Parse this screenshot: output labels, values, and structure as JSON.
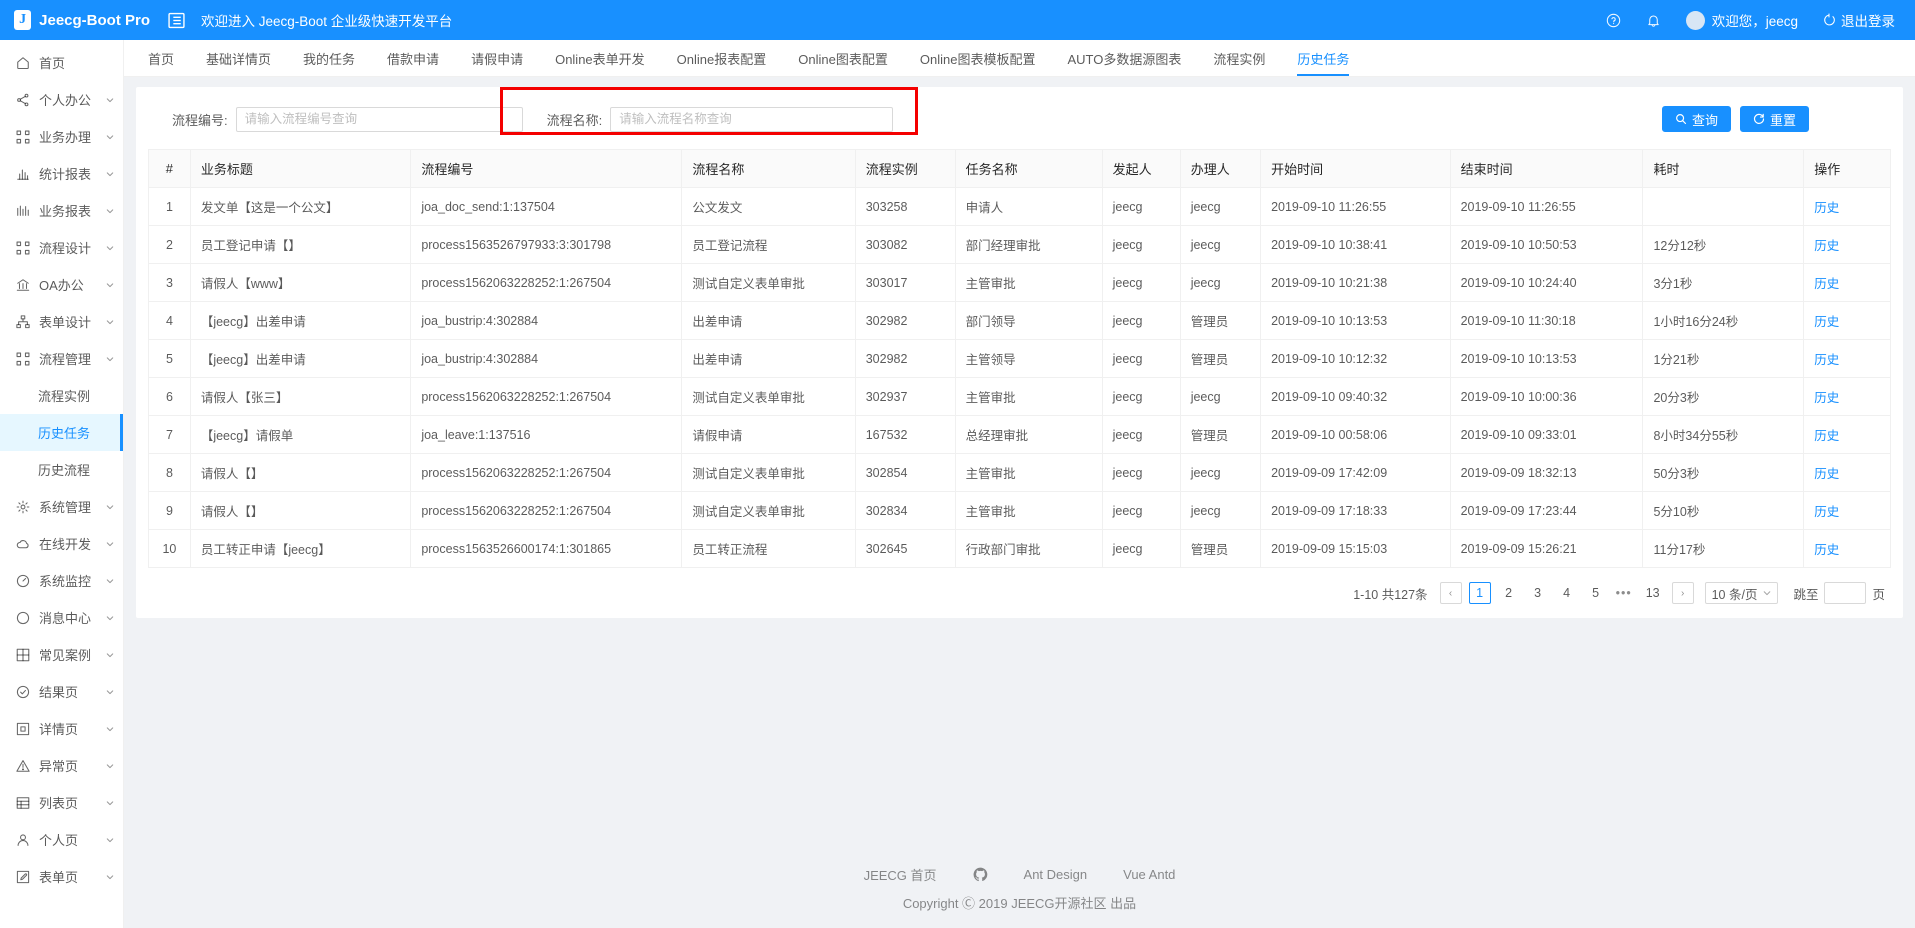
{
  "header": {
    "brand_initial": "J",
    "brand_name": "Jeecg-Boot Pro",
    "welcome_banner": "欢迎进入 Jeecg-Boot 企业级快速开发平台",
    "help_icon": "question-circle-icon",
    "bell_icon": "bell-icon",
    "user_label": "欢迎您，jeecg",
    "logout_label": "退出登录"
  },
  "sidebar": {
    "items": [
      {
        "label": "首页",
        "icon": "home-icon",
        "has_arrow": false,
        "selected": false,
        "sub": false
      },
      {
        "label": "个人办公",
        "icon": "share-icon",
        "has_arrow": true,
        "selected": false,
        "sub": false
      },
      {
        "label": "业务办理",
        "icon": "cluster-icon",
        "has_arrow": true,
        "selected": false,
        "sub": false
      },
      {
        "label": "统计报表",
        "icon": "bar-chart-icon",
        "has_arrow": true,
        "selected": false,
        "sub": false
      },
      {
        "label": "业务报表",
        "icon": "chart-icon",
        "has_arrow": true,
        "selected": false,
        "sub": false
      },
      {
        "label": "流程设计",
        "icon": "cluster-icon",
        "has_arrow": true,
        "selected": false,
        "sub": false
      },
      {
        "label": "OA办公",
        "icon": "bank-icon",
        "has_arrow": true,
        "selected": false,
        "sub": false
      },
      {
        "label": "表单设计",
        "icon": "apartment-icon",
        "has_arrow": true,
        "selected": false,
        "sub": false
      },
      {
        "label": "流程管理",
        "icon": "cluster-icon",
        "has_arrow": true,
        "selected": false,
        "sub": false
      },
      {
        "label": "流程实例",
        "icon": "",
        "has_arrow": false,
        "selected": false,
        "sub": true
      },
      {
        "label": "历史任务",
        "icon": "",
        "has_arrow": false,
        "selected": true,
        "sub": true
      },
      {
        "label": "历史流程",
        "icon": "",
        "has_arrow": false,
        "selected": false,
        "sub": true
      },
      {
        "label": "系统管理",
        "icon": "gear-icon",
        "has_arrow": true,
        "selected": false,
        "sub": false
      },
      {
        "label": "在线开发",
        "icon": "cloud-icon",
        "has_arrow": true,
        "selected": false,
        "sub": false
      },
      {
        "label": "系统监控",
        "icon": "dashboard-icon",
        "has_arrow": true,
        "selected": false,
        "sub": false
      },
      {
        "label": "消息中心",
        "icon": "circle-icon",
        "has_arrow": true,
        "selected": false,
        "sub": false
      },
      {
        "label": "常见案例",
        "icon": "grid-icon",
        "has_arrow": true,
        "selected": false,
        "sub": false
      },
      {
        "label": "结果页",
        "icon": "check-circle-icon",
        "has_arrow": true,
        "selected": false,
        "sub": false
      },
      {
        "label": "详情页",
        "icon": "profile-icon",
        "has_arrow": true,
        "selected": false,
        "sub": false
      },
      {
        "label": "异常页",
        "icon": "warning-icon",
        "has_arrow": true,
        "selected": false,
        "sub": false
      },
      {
        "label": "列表页",
        "icon": "table-icon",
        "has_arrow": true,
        "selected": false,
        "sub": false
      },
      {
        "label": "个人页",
        "icon": "user-icon",
        "has_arrow": true,
        "selected": false,
        "sub": false
      },
      {
        "label": "表单页",
        "icon": "form-icon",
        "has_arrow": true,
        "selected": false,
        "sub": false
      }
    ]
  },
  "tabs": [
    {
      "label": "首页",
      "active": false
    },
    {
      "label": "基础详情页",
      "active": false
    },
    {
      "label": "我的任务",
      "active": false
    },
    {
      "label": "借款申请",
      "active": false
    },
    {
      "label": "请假申请",
      "active": false
    },
    {
      "label": "Online表单开发",
      "active": false
    },
    {
      "label": "Online报表配置",
      "active": false
    },
    {
      "label": "Online图表配置",
      "active": false
    },
    {
      "label": "Online图表模板配置",
      "active": false
    },
    {
      "label": "AUTO多数据源图表",
      "active": false
    },
    {
      "label": "流程实例",
      "active": false
    },
    {
      "label": "历史任务",
      "active": true
    }
  ],
  "search": {
    "process_no_label": "流程编号:",
    "process_no_placeholder": "请输入流程编号查询",
    "process_no_value": "",
    "process_name_label": "流程名称:",
    "process_name_placeholder": "请输入流程名称查询",
    "process_name_value": "",
    "query_button": "查询",
    "reset_button": "重置",
    "query_icon": "search-icon",
    "reset_icon": "reload-icon",
    "highlight_color": "#f40000"
  },
  "table": {
    "columns": [
      "#",
      "业务标题",
      "流程编号",
      "流程名称",
      "流程实例",
      "任务名称",
      "发起人",
      "办理人",
      "开始时间",
      "结束时间",
      "耗时",
      "操作"
    ],
    "action_label": "历史",
    "rows": [
      {
        "idx": "1",
        "title": "发文单【这是一个公文】",
        "code": "joa_doc_send:1:137504",
        "pname": "公文发文",
        "pinst": "303258",
        "task": "申请人",
        "starter": "jeecg",
        "handler": "jeecg",
        "stime": "2019-09-10 11:26:55",
        "etime": "2019-09-10 11:26:55",
        "dur": ""
      },
      {
        "idx": "2",
        "title": "员工登记申请【】",
        "code": "process1563526797933:3:301798",
        "pname": "员工登记流程",
        "pinst": "303082",
        "task": "部门经理审批",
        "starter": "jeecg",
        "handler": "jeecg",
        "stime": "2019-09-10 10:38:41",
        "etime": "2019-09-10 10:50:53",
        "dur": "12分12秒"
      },
      {
        "idx": "3",
        "title": "请假人【www】",
        "code": "process1562063228252:1:267504",
        "pname": "测试自定义表单审批",
        "pinst": "303017",
        "task": "主管审批",
        "starter": "jeecg",
        "handler": "jeecg",
        "stime": "2019-09-10 10:21:38",
        "etime": "2019-09-10 10:24:40",
        "dur": "3分1秒"
      },
      {
        "idx": "4",
        "title": "【jeecg】出差申请",
        "code": "joa_bustrip:4:302884",
        "pname": "出差申请",
        "pinst": "302982",
        "task": "部门领导",
        "starter": "jeecg",
        "handler": "管理员",
        "stime": "2019-09-10 10:13:53",
        "etime": "2019-09-10 11:30:18",
        "dur": "1小时16分24秒"
      },
      {
        "idx": "5",
        "title": "【jeecg】出差申请",
        "code": "joa_bustrip:4:302884",
        "pname": "出差申请",
        "pinst": "302982",
        "task": "主管领导",
        "starter": "jeecg",
        "handler": "管理员",
        "stime": "2019-09-10 10:12:32",
        "etime": "2019-09-10 10:13:53",
        "dur": "1分21秒"
      },
      {
        "idx": "6",
        "title": "请假人【张三】",
        "code": "process1562063228252:1:267504",
        "pname": "测试自定义表单审批",
        "pinst": "302937",
        "task": "主管审批",
        "starter": "jeecg",
        "handler": "jeecg",
        "stime": "2019-09-10 09:40:32",
        "etime": "2019-09-10 10:00:36",
        "dur": "20分3秒"
      },
      {
        "idx": "7",
        "title": "【jeecg】请假单",
        "code": "joa_leave:1:137516",
        "pname": "请假申请",
        "pinst": "167532",
        "task": "总经理审批",
        "starter": "jeecg",
        "handler": "管理员",
        "stime": "2019-09-10 00:58:06",
        "etime": "2019-09-10 09:33:01",
        "dur": "8小时34分55秒"
      },
      {
        "idx": "8",
        "title": "请假人【】",
        "code": "process1562063228252:1:267504",
        "pname": "测试自定义表单审批",
        "pinst": "302854",
        "task": "主管审批",
        "starter": "jeecg",
        "handler": "jeecg",
        "stime": "2019-09-09 17:42:09",
        "etime": "2019-09-09 18:32:13",
        "dur": "50分3秒"
      },
      {
        "idx": "9",
        "title": "请假人【】",
        "code": "process1562063228252:1:267504",
        "pname": "测试自定义表单审批",
        "pinst": "302834",
        "task": "主管审批",
        "starter": "jeecg",
        "handler": "jeecg",
        "stime": "2019-09-09 17:18:33",
        "etime": "2019-09-09 17:23:44",
        "dur": "5分10秒"
      },
      {
        "idx": "10",
        "title": "员工转正申请【jeecg】",
        "code": "process1563526600174:1:301865",
        "pname": "员工转正流程",
        "pinst": "302645",
        "task": "行政部门审批",
        "starter": "jeecg",
        "handler": "管理员",
        "stime": "2019-09-09 15:15:03",
        "etime": "2019-09-09 15:26:21",
        "dur": "11分17秒"
      }
    ]
  },
  "pagination": {
    "total_text": "1-10 共127条",
    "prev_icon": "chevron-left-icon",
    "next_icon": "chevron-right-icon",
    "pages": [
      "1",
      "2",
      "3",
      "4",
      "5"
    ],
    "current_page": "1",
    "ellipsis": "•••",
    "last_page": "13",
    "page_size_label": "10 条/页",
    "jump_prefix": "跳至",
    "jump_value": "",
    "jump_suffix": "页"
  },
  "footer": {
    "links": [
      {
        "label": "JEECG 首页",
        "icon": ""
      },
      {
        "label": "",
        "icon": "github-icon"
      },
      {
        "label": "Ant Design",
        "icon": ""
      },
      {
        "label": "Vue Antd",
        "icon": ""
      }
    ],
    "copyright": "Copyright Ⓒ 2019 JEECG开源社区 出品"
  }
}
